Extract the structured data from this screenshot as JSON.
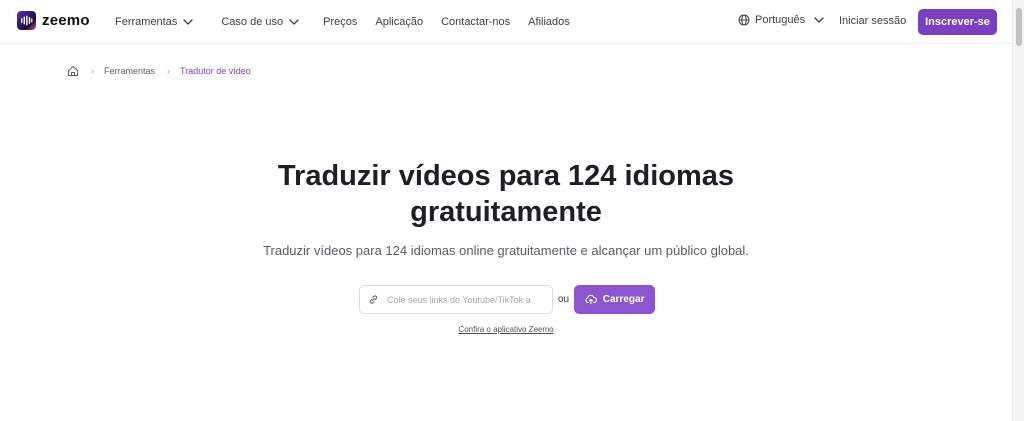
{
  "brand": {
    "name": "zeemo",
    "accent_color": "#7b3fc4",
    "button_color": "#8a55cf"
  },
  "nav": {
    "items": [
      {
        "label": "Ferramentas",
        "has_dropdown": true
      },
      {
        "label": "Caso de uso",
        "has_dropdown": true
      },
      {
        "label": "Preços",
        "has_dropdown": false
      },
      {
        "label": "Aplicação",
        "has_dropdown": false
      },
      {
        "label": "Contactar-nos",
        "has_dropdown": false
      },
      {
        "label": "Afiliados",
        "has_dropdown": false
      }
    ],
    "language": "Português",
    "login_label": "Iniciar sessão",
    "signup_label": "Inscrever-se"
  },
  "breadcrumb": {
    "home_icon": "home-icon",
    "items": [
      "Ferramentas",
      "Tradutor de vídeo"
    ]
  },
  "hero": {
    "title_line1": "Traduzir vídeos para 124 idiomas",
    "title_line2": "gratuitamente",
    "subtitle": "Traduzir vídeos para 124 idiomas online gratuitamente e alcançar um público global.",
    "link_placeholder": "Cole seus links do Youtube/TikTok a",
    "or_label": "ou",
    "upload_label": "Carregar",
    "app_link_label": "Confira o aplicativo Zeemo"
  }
}
